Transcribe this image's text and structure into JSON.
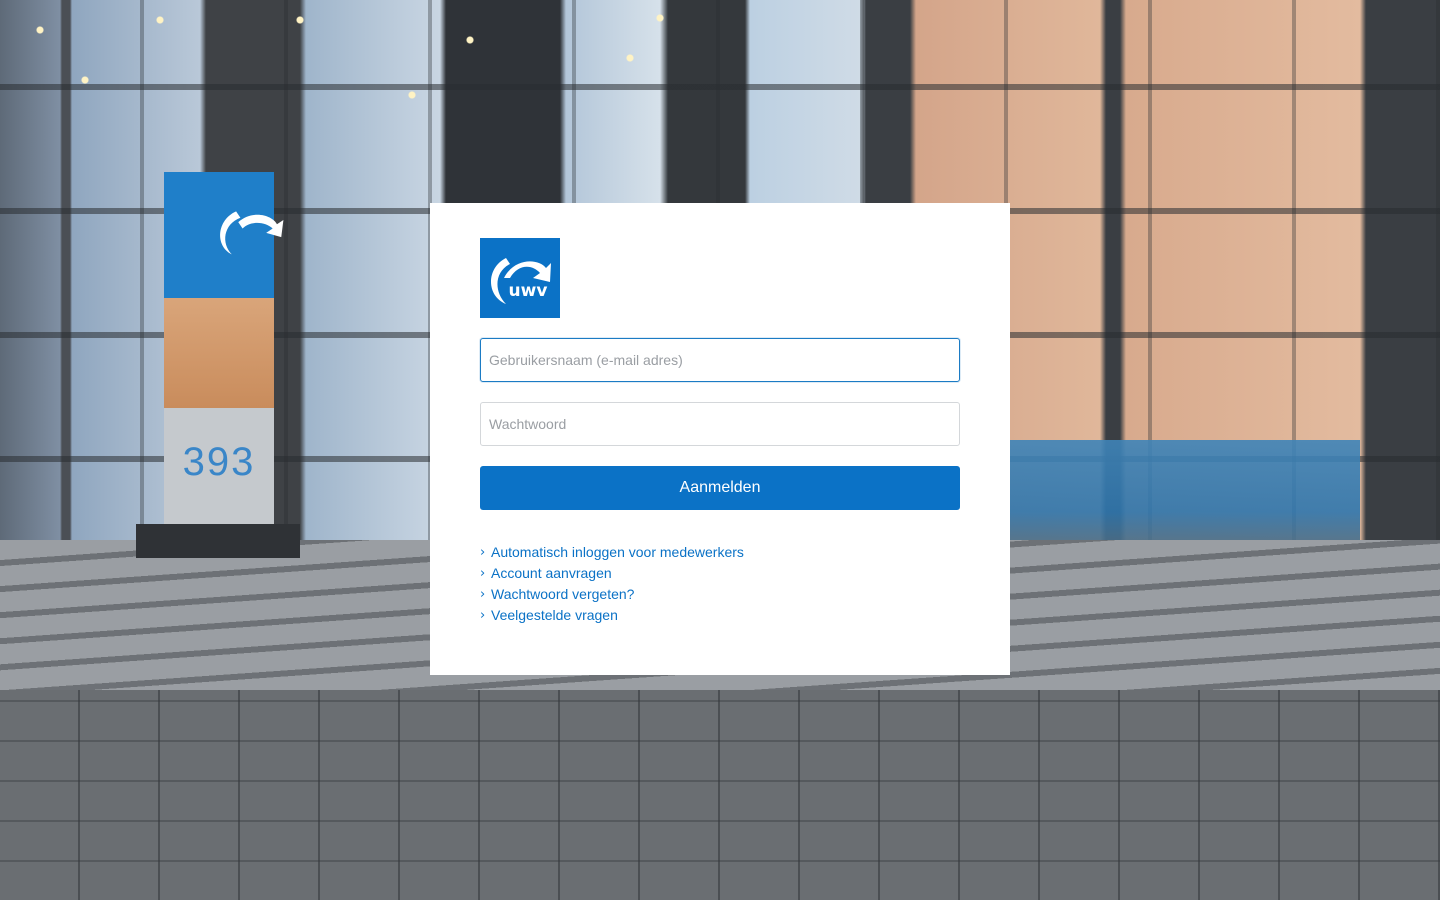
{
  "background": {
    "description_icon": "building-entrance-photo",
    "sign_number": "393"
  },
  "logo": {
    "text": "uwv",
    "icon": "uwv-logo-icon",
    "brand_color": "#0b72c6"
  },
  "form": {
    "username_placeholder": "Gebruikersnaam (e-mail adres)",
    "username_value": "",
    "password_placeholder": "Wachtwoord",
    "password_value": "",
    "submit_label": "Aanmelden"
  },
  "links": [
    {
      "label": "Automatisch inloggen voor medewerkers",
      "icon": "chevron-right-icon"
    },
    {
      "label": "Account aanvragen",
      "icon": "chevron-right-icon"
    },
    {
      "label": "Wachtwoord vergeten?",
      "icon": "chevron-right-icon"
    },
    {
      "label": "Veelgestelde vragen",
      "icon": "chevron-right-icon"
    }
  ],
  "colors": {
    "accent": "#0b72c6",
    "field_border": "#d4d7da",
    "field_focus_border": "#1b7bc4",
    "card_bg": "#ffffff"
  }
}
